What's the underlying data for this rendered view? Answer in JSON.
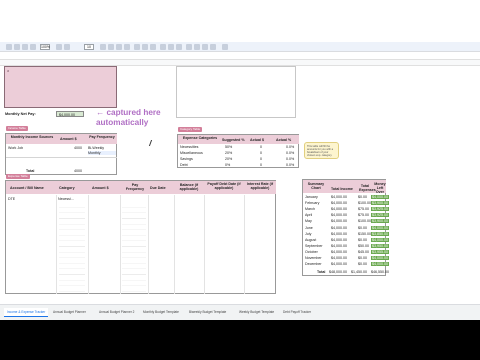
{
  "annotation": {
    "line1": "← captured here",
    "line2": "automatically"
  },
  "top_summary": {
    "label": "Monthly Net Pay:",
    "value": "$4,000.00"
  },
  "income_table": {
    "tag": "Income Table",
    "headers": [
      "Monthly Income Sources",
      "Amount $",
      "Pay Frequency"
    ],
    "rows": [
      {
        "source": "Work Job",
        "amount": "4000",
        "freq": "Bi-Weekly"
      },
      {
        "source": "",
        "amount": "",
        "freq": "Monthly"
      }
    ],
    "total_label": "Total",
    "total_value": "4000"
  },
  "category_table": {
    "tag": "Category Table",
    "headers": [
      "Expense Categories",
      "Suggested %",
      "Actual $",
      "Actual %"
    ],
    "rows": [
      {
        "cat": "Necessities",
        "sugg": "50%",
        "actual": "0",
        "pct": "0.0%"
      },
      {
        "cat": "Miscellaneous",
        "sugg": "20%",
        "actual": "0",
        "pct": "0.0%"
      },
      {
        "cat": "Savings",
        "sugg": "20%",
        "actual": "0",
        "pct": "0.0%"
      },
      {
        "cat": "Debt",
        "sugg": "0%",
        "actual": "0",
        "pct": "0.0%"
      }
    ]
  },
  "note_text": "This table will fill the amounts for you with a breakdown of your chosen exp. category.",
  "expense_table": {
    "tag": "Expense Table",
    "headers": [
      "Account / Bill Name",
      "Category",
      "Amount $",
      "Pay Frequency",
      "Due Date",
      "Balance (if applicable)",
      "Payoff Debt Date (if applicable)",
      "Interest Rate (if applicable)"
    ],
    "first_row": {
      "name": "DTE",
      "category": "Necessi..."
    }
  },
  "summary_table": {
    "headers": [
      "Summary Chart",
      "Total Income",
      "Total Expenses",
      "Money Left Over"
    ],
    "rows": [
      {
        "month": "January",
        "income": "$4,000.00",
        "expenses": "$0.00",
        "left": "$4,000.00"
      },
      {
        "month": "February",
        "income": "$4,000.00",
        "expenses": "$100.00",
        "left": "$3,900.00"
      },
      {
        "month": "March",
        "income": "$4,000.00",
        "expenses": "$75.00",
        "left": "$3,925.00"
      },
      {
        "month": "April",
        "income": "$4,000.00",
        "expenses": "$75.00",
        "left": "$3,925.00"
      },
      {
        "month": "May",
        "income": "$4,000.00",
        "expenses": "$100.00",
        "left": "$3,900.00"
      },
      {
        "month": "June",
        "income": "$4,000.00",
        "expenses": "$0.00",
        "left": "$4,000.00"
      },
      {
        "month": "July",
        "income": "$4,000.00",
        "expenses": "$150.00",
        "left": "$3,850.00"
      },
      {
        "month": "August",
        "income": "$4,000.00",
        "expenses": "$0.00",
        "left": "$4,000.00"
      },
      {
        "month": "September",
        "income": "$4,000.00",
        "expenses": "$50.00",
        "left": "$3,950.00"
      },
      {
        "month": "October",
        "income": "$4,000.00",
        "expenses": "$45.00",
        "left": "$3,955.00"
      },
      {
        "month": "November",
        "income": "$4,000.00",
        "expenses": "$0.00",
        "left": "$4,000.00"
      },
      {
        "month": "December",
        "income": "$4,000.00",
        "expenses": "$0.00",
        "left": "$4,000.00"
      }
    ],
    "total_label": "Total",
    "total_income": "$48,000.00",
    "total_expenses": "$1,450.00",
    "total_left": "$46,550.00"
  },
  "sheet_tabs": [
    "Income & Expense Tracker",
    "Annual Budget Planner",
    "Annual Budget Planner 2",
    "Monthly Budget Template",
    "Biweekly Budget Template",
    "Weekly Budget Template",
    "Debt Payoff Tracker"
  ],
  "toolbar": {
    "zoom": "100%",
    "font_size": "10"
  },
  "colors": {
    "pink": "#eccdd8",
    "green": "#6aa84f",
    "header_tag": "#d37f9a",
    "annotation": "#b06fc4"
  }
}
